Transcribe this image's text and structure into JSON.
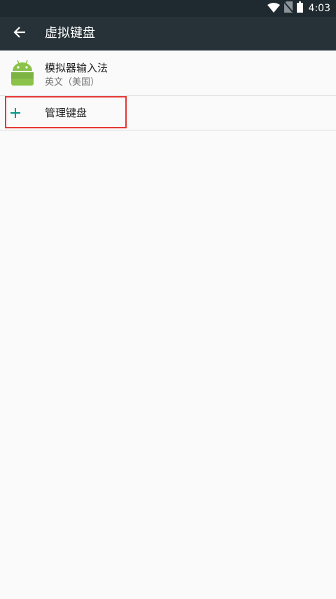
{
  "status_bar": {
    "time": "4:03",
    "icons": [
      "wifi-icon",
      "no-sim-icon",
      "battery-icon"
    ]
  },
  "app_bar": {
    "title": "虚拟键盘",
    "back_icon": "arrow-back-icon"
  },
  "keyboards": [
    {
      "name": "模拟器输入法",
      "language": "英文（美国）",
      "icon": "android-icon"
    }
  ],
  "manage": {
    "label": "管理键盘",
    "icon": "plus-icon"
  },
  "colors": {
    "status_bar": "#1f2a30",
    "app_bar": "#263238",
    "background": "#fafafa",
    "accent": "#009688",
    "android_green": "#8bc34a",
    "highlight": "#e53935"
  }
}
